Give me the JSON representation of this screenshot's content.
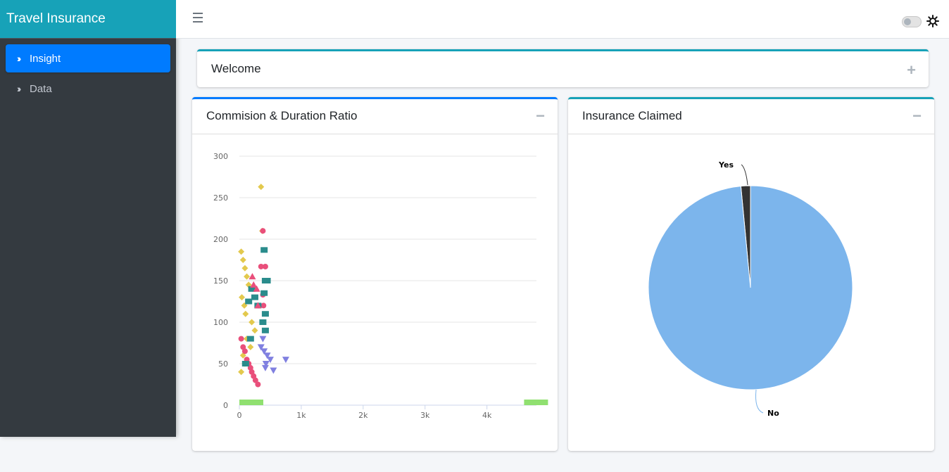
{
  "app": {
    "brand": "Travel Insurance"
  },
  "sidebar": {
    "items": [
      {
        "label": "Insight",
        "active": true
      },
      {
        "label": "Data",
        "active": false
      }
    ]
  },
  "header": {
    "menu_icon": "hamburger-icon",
    "theme_icon": "sun-icon"
  },
  "welcome": {
    "title": "Welcome",
    "tool": "+"
  },
  "scatter_card": {
    "title": "Commision & Duration Ratio",
    "tool": "−"
  },
  "pie_card": {
    "title": "Insurance Claimed",
    "tool": "−"
  },
  "colors": {
    "sidebar": "#343a40",
    "brand": "#17a2b8",
    "accent": "#007bff",
    "series": [
      "#e3c94d",
      "#e94f7b",
      "#2a8c8c",
      "#8080e0",
      "#90e070",
      "#333333"
    ]
  },
  "chart_data": [
    {
      "type": "scatter",
      "xlim": [
        0,
        4800
      ],
      "ylim": [
        0,
        300
      ],
      "x_ticks": [
        "0",
        "1k",
        "2k",
        "3k",
        "4k"
      ],
      "x_tick_values": [
        0,
        1000,
        2000,
        3000,
        4000
      ],
      "y_ticks": [
        0,
        50,
        100,
        150,
        200,
        250,
        300
      ],
      "grid": true,
      "series": [
        {
          "marker": "diamond",
          "color": "#e3c94d",
          "x": [
            30,
            60,
            90,
            120,
            150,
            40,
            80,
            100,
            200,
            250,
            350,
            370,
            120,
            180,
            60,
            90,
            30
          ],
          "y": [
            185,
            175,
            165,
            155,
            145,
            130,
            120,
            110,
            100,
            90,
            263,
            210,
            80,
            70,
            60,
            50,
            40
          ]
        },
        {
          "marker": "circle",
          "color": "#e94f7b",
          "x": [
            30,
            60,
            90,
            120,
            150,
            180,
            200,
            230,
            260,
            300,
            380,
            420,
            380,
            390,
            350
          ],
          "y": [
            80,
            70,
            65,
            55,
            50,
            45,
            40,
            35,
            30,
            25,
            210,
            167,
            133,
            120,
            167
          ]
        },
        {
          "marker": "square",
          "color": "#2a8c8c",
          "x": [
            400,
            420,
            450,
            400,
            420,
            200,
            250,
            300,
            150,
            380,
            420,
            100,
            180
          ],
          "y": [
            187,
            150,
            150,
            135,
            110,
            140,
            130,
            120,
            125,
            100,
            90,
            50,
            80
          ]
        },
        {
          "marker": "triangle-down",
          "color": "#8080e0",
          "x": [
            400,
            450,
            500,
            750,
            550,
            430,
            350,
            380,
            420
          ],
          "y": [
            65,
            60,
            55,
            55,
            42,
            50,
            70,
            80,
            45
          ]
        },
        {
          "marker": "triangle",
          "color": "#e94f7b",
          "x": [
            210,
            230,
            280,
            300
          ],
          "y": [
            155,
            145,
            140,
            120
          ]
        },
        {
          "marker": "bar",
          "color": "#90e070",
          "x": [
            0,
            4600
          ],
          "y": [
            0,
            0
          ]
        }
      ]
    },
    {
      "type": "pie",
      "labels": [
        "Yes",
        "No"
      ],
      "values": [
        1.5,
        98.5
      ],
      "colors": [
        "#333333",
        "#7cb5ec"
      ]
    }
  ]
}
